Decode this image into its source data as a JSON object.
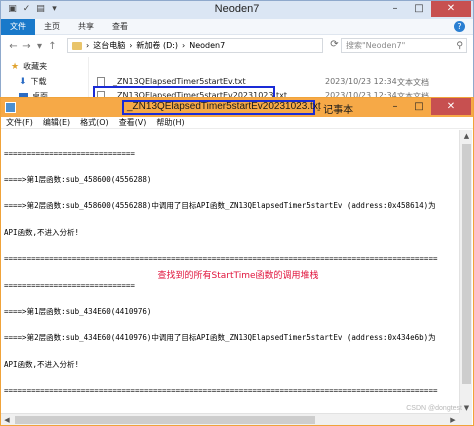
{
  "explorer": {
    "title": "Neoden7",
    "menu_file": "文件",
    "menu_home": "主页",
    "menu_share": "共享",
    "menu_view": "查看",
    "breadcrumb": [
      "这台电脑",
      "新加卷 (D:)",
      "Neoden7"
    ],
    "search_placeholder": "搜索\"Neoden7\"",
    "sidebar": [
      "收藏夹",
      "下载",
      "桌面"
    ],
    "files": [
      {
        "name": "_ZN13QElapsedTimer5startEv.txt",
        "date": "2023/10/23 12:34",
        "type": "文本文档"
      },
      {
        "name": "_ZN13QElapsedTimer5startEv20231023.txt",
        "date": "2023/10/23 12:34",
        "type": "文本文档"
      }
    ]
  },
  "notepad": {
    "title_file": "_ZN13QElapsedTimer5startEv20231023.txt",
    "title_app": "- 记事本",
    "menu": [
      "文件(F)",
      "编辑(E)",
      "格式(O)",
      "查看(V)",
      "帮助(H)"
    ],
    "lines": [
      "=============================",
      "====>第1层函数:sub_458600(4556288)",
      "====>第2层函数:sub_458600(4556288)中调用了目标API函数_ZN13QElapsedTimer5startEv (address:0x458614)为",
      "API函数,不进入分析!",
      "================================================================================================",
      "=============================",
      "====>第1层函数:sub_434E60(4410976)",
      "====>第2层函数:sub_434E60(4410976)中调用了目标API函数_ZN13QElapsedTimer5startEv (address:0x434e6b)为",
      "API函数,不进入分析!",
      "================================================================================================",
      "============================="
    ],
    "annotation": "查找到的所有StartTime函数的调用堆栈"
  },
  "watermark": "CSDN @dongtest"
}
